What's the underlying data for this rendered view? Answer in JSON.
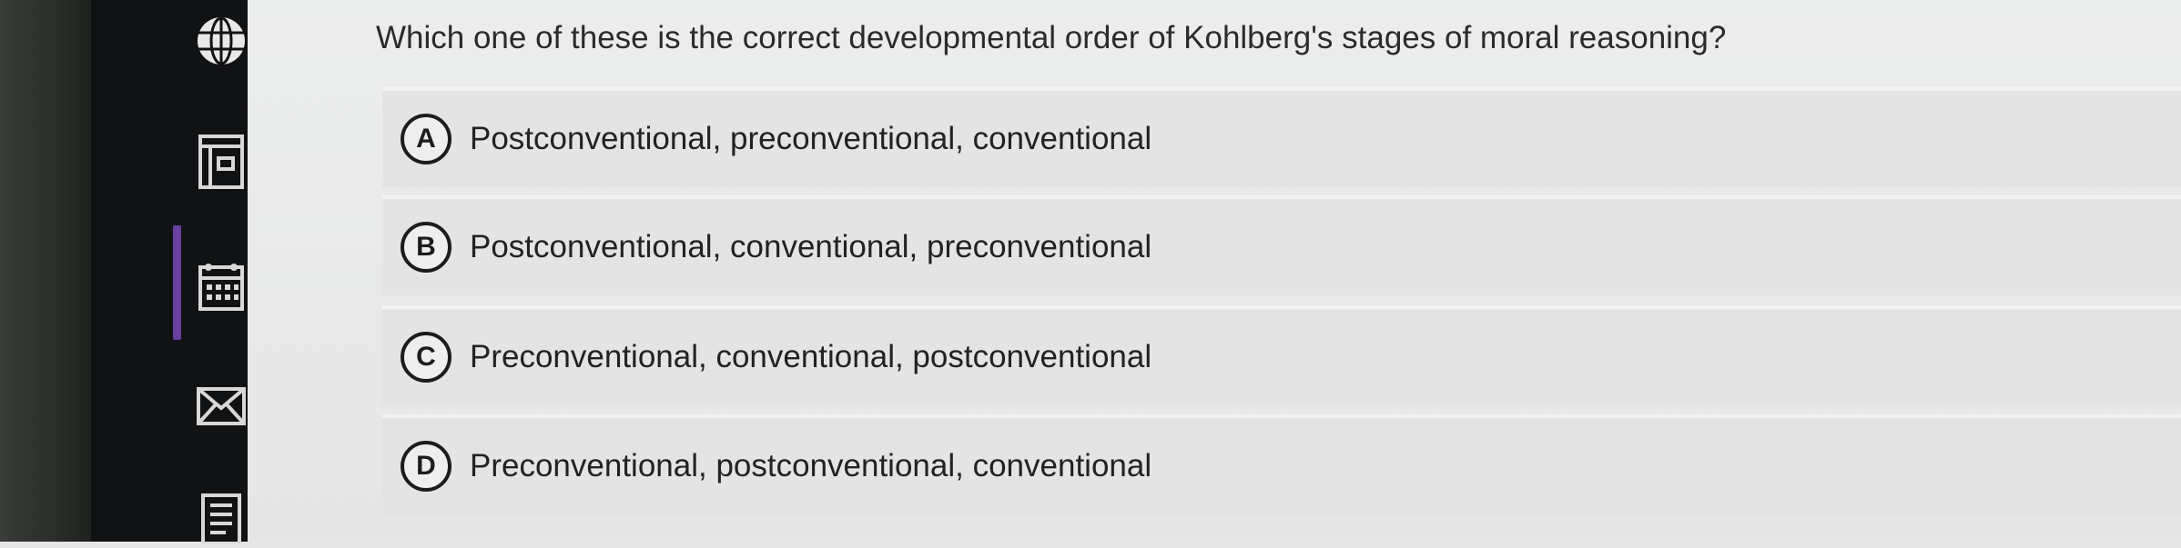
{
  "question": "Which one of these is the correct developmental order of Kohlberg's stages of moral reasoning?",
  "options": [
    {
      "letter": "A",
      "text": "Postconventional, preconventional, conventional"
    },
    {
      "letter": "B",
      "text": "Postconventional, conventional, preconventional"
    },
    {
      "letter": "C",
      "text": "Preconventional, conventional, postconventional"
    },
    {
      "letter": "D",
      "text": "Preconventional, postconventional, conventional"
    }
  ],
  "sidebar": {
    "icons": [
      "globe-icon",
      "book-icon",
      "calendar-icon",
      "mail-icon",
      "document-icon"
    ],
    "active_color": "#6b3fa0"
  }
}
